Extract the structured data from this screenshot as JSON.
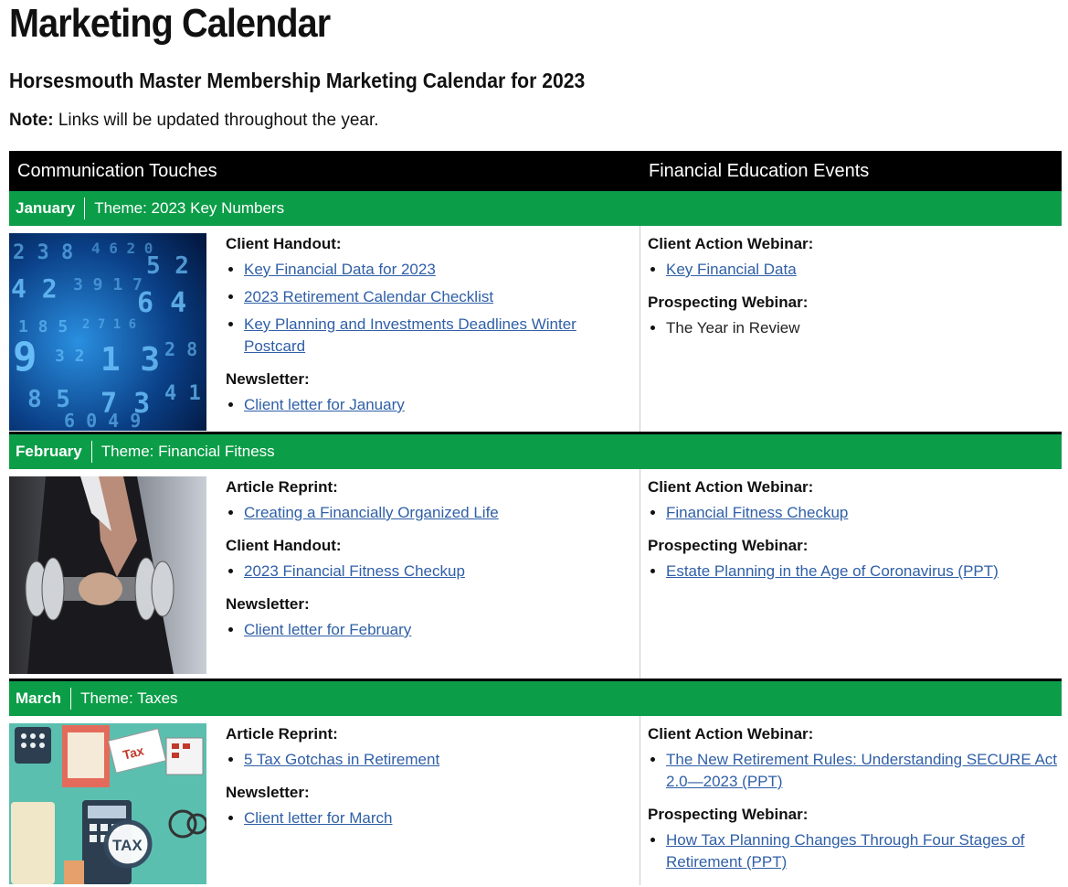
{
  "page": {
    "title": "Marketing Calendar",
    "subtitle": "Horsesmouth Master Membership Marketing Calendar for 2023",
    "note_label": "Note:",
    "note_text": " Links will be updated throughout the year."
  },
  "table": {
    "col1_header": "Communication Touches",
    "col2_header": "Financial Education Events"
  },
  "months": [
    {
      "name": "January",
      "theme": "Theme: 2023 Key Numbers",
      "image_icon": "blue-digital-numbers-image",
      "left_sections": [
        {
          "label": "Client Handout:",
          "items": [
            "Key Financial Data for 2023",
            "2023 Retirement Calendar Checklist",
            "Key Planning and Investments Deadlines Winter Postcard"
          ]
        },
        {
          "label": "Newsletter:",
          "items": [
            "Client letter for January"
          ]
        }
      ],
      "right_sections": [
        {
          "label": "Client Action Webinar:",
          "items": [
            "Key Financial Data"
          ]
        },
        {
          "label": "Prospecting Webinar:",
          "items": [
            "The Year in Review"
          ]
        }
      ]
    },
    {
      "name": "February",
      "theme": "Theme: Financial Fitness",
      "image_icon": "businessman-dumbbell-image",
      "left_sections": [
        {
          "label": "Article Reprint:",
          "items": [
            "Creating a Financially Organized Life"
          ]
        },
        {
          "label": "Client Handout:",
          "items": [
            "2023 Financial Fitness Checkup"
          ]
        },
        {
          "label": "Newsletter:",
          "items": [
            "Client letter for February"
          ]
        }
      ],
      "right_sections": [
        {
          "label": "Client Action Webinar:",
          "items": [
            "Financial Fitness Checkup"
          ]
        },
        {
          "label": "Prospecting Webinar:",
          "items": [
            "Estate Planning in the Age of Coronavirus (PPT)"
          ]
        }
      ]
    },
    {
      "name": "March",
      "theme": "Theme: Taxes",
      "image_icon": "tax-documents-illustration-image",
      "left_sections": [
        {
          "label": "Article Reprint:",
          "items": [
            "5 Tax Gotchas in Retirement"
          ]
        },
        {
          "label": "Newsletter:",
          "items": [
            "Client letter for March"
          ]
        }
      ],
      "right_sections": [
        {
          "label": "Client Action Webinar:",
          "items": [
            "The New Retirement Rules: Understanding SECURE Act 2.0—2023 (PPT)"
          ]
        },
        {
          "label": "Prospecting Webinar:",
          "items": [
            "How Tax Planning Changes Through Four Stages of Retirement (PPT)"
          ]
        }
      ]
    }
  ],
  "colors": {
    "green": "#0c9d48",
    "header_black": "#000000",
    "link_blue": "#2f5fa7"
  }
}
